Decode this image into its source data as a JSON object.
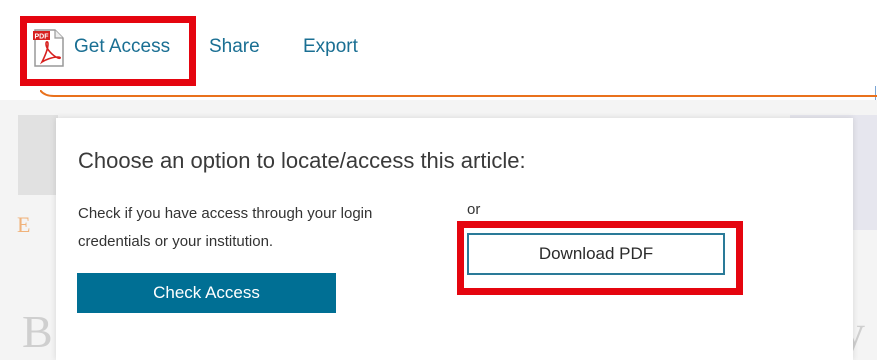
{
  "toolbar": {
    "get_access_label": "Get Access",
    "share_label": "Share",
    "export_label": "Export",
    "pdf_icon_text": "PDF"
  },
  "modal": {
    "title": "Choose an option to locate/access this article:",
    "description": "Check if you have access through your login credentials or your institution.",
    "or_label": "or",
    "check_access_label": "Check Access",
    "download_pdf_label": "Download PDF"
  },
  "background": {
    "letter_e": "E",
    "letter_b": "B",
    "letter_y": "y"
  },
  "colors": {
    "link": "#1a6f93",
    "primary_button": "#006f94",
    "highlight": "#e5050f",
    "accent_line": "#e9711c"
  }
}
